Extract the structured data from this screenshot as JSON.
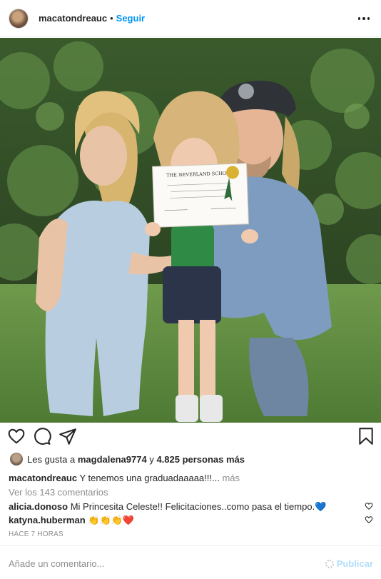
{
  "post": {
    "header": {
      "username": "macatondreauc",
      "separator": "•",
      "follow_label": "Seguir",
      "more_icon": "more-horizontal-icon"
    },
    "photo": {
      "alt": "macatondreauc post photo",
      "certificate_title": "THE NEVERLAND SCHOOL"
    },
    "actions": {
      "like_icon": "heart-outline-icon",
      "comment_icon": "comment-bubble-icon",
      "share_icon": "paper-plane-icon",
      "save_icon": "bookmark-icon"
    },
    "likes": {
      "prefix": "Les gusta a",
      "liker": "magdalena9774",
      "joiner": "y",
      "others": "4.825 personas más"
    },
    "caption": {
      "username": "macatondreauc",
      "text": "Y tenemos una graduadaaaaa!!!...",
      "more_label": "más"
    },
    "view_comments_label": "Ver los 143 comentarios",
    "comments": [
      {
        "username": "alicia.donoso",
        "text": "Mi Princesita Celeste!! Felicitaciones..como pasa el tiempo.💙"
      },
      {
        "username": "katyna.huberman",
        "text": "👏👏👏❤️"
      }
    ],
    "timestamp": "Hace 7 horas",
    "comment_box": {
      "placeholder": "Añade un comentario...",
      "publish_label": "Publicar"
    }
  },
  "colors": {
    "link_blue": "#0095f6",
    "publish_disabled": "#b2dffc",
    "muted": "#8e8e8e",
    "text": "#262626"
  }
}
